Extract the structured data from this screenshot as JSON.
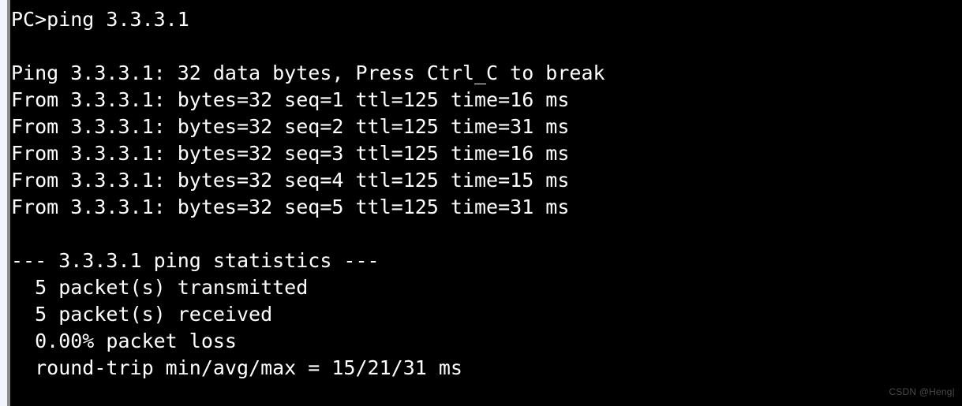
{
  "terminal": {
    "background_color": "#000000",
    "text_color": "#ffffff",
    "left_strip_color": "#f2f5fc",
    "left_divider_color": "#8d8d8d",
    "prompt": "PC>",
    "command": "ping 3.3.3.1",
    "prompt_line": "PC>ping 3.3.3.1",
    "lines": [
      "PC>ping 3.3.3.1",
      "",
      "Ping 3.3.3.1: 32 data bytes, Press Ctrl_C to break",
      "From 3.3.3.1: bytes=32 seq=1 ttl=125 time=16 ms",
      "From 3.3.3.1: bytes=32 seq=2 ttl=125 time=31 ms",
      "From 3.3.3.1: bytes=32 seq=3 ttl=125 time=16 ms",
      "From 3.3.3.1: bytes=32 seq=4 ttl=125 time=15 ms",
      "From 3.3.3.1: bytes=32 seq=5 ttl=125 time=31 ms",
      "",
      "--- 3.3.3.1 ping statistics ---",
      "  5 packet(s) transmitted",
      "  5 packet(s) received",
      "  0.00% packet loss",
      "  round-trip min/avg/max = 15/21/31 ms"
    ],
    "ping": {
      "target": "3.3.3.1",
      "data_bytes": "32",
      "break_hint": "Press Ctrl_C to break",
      "header_line": "Ping 3.3.3.1: 32 data bytes, Press Ctrl_C to break",
      "replies": [
        {
          "source": "3.3.3.1",
          "bytes": "32",
          "seq": "1",
          "ttl": "125",
          "time": "16",
          "unit": "ms"
        },
        {
          "source": "3.3.3.1",
          "bytes": "32",
          "seq": "2",
          "ttl": "125",
          "time": "31",
          "unit": "ms"
        },
        {
          "source": "3.3.3.1",
          "bytes": "32",
          "seq": "3",
          "ttl": "125",
          "time": "16",
          "unit": "ms"
        },
        {
          "source": "3.3.3.1",
          "bytes": "32",
          "seq": "4",
          "ttl": "125",
          "time": "15",
          "unit": "ms"
        },
        {
          "source": "3.3.3.1",
          "bytes": "32",
          "seq": "5",
          "ttl": "125",
          "time": "31",
          "unit": "ms"
        }
      ],
      "statistics": {
        "header": "--- 3.3.3.1 ping statistics ---",
        "transmitted": "  5 packet(s) transmitted",
        "received": "  5 packet(s) received",
        "loss": "  0.00% packet loss",
        "round_trip": "  round-trip min/avg/max = 15/21/31 ms",
        "transmitted_count": "5",
        "received_count": "5",
        "loss_percent": "0.00%",
        "rtt_min": "15",
        "rtt_avg": "21",
        "rtt_max": "31",
        "rtt_unit": "ms"
      }
    }
  },
  "watermark": {
    "text": "CSDN @Heng|",
    "color": "#4a4a4a"
  }
}
